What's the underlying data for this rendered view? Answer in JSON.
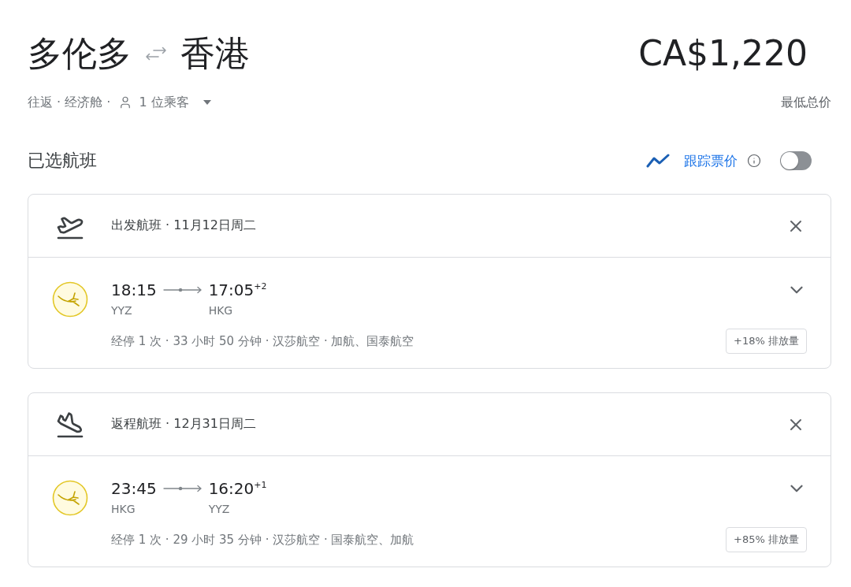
{
  "route": {
    "origin": "多伦多",
    "destination": "香港"
  },
  "price": {
    "amount": "CA$1,220",
    "note": "最低总价"
  },
  "trip": {
    "summary": "往返 · 经济舱 ·",
    "passengers": "1 位乘客"
  },
  "selected_flights": {
    "title": "已选航班",
    "track_prices": {
      "label": "跟踪票价",
      "on": false
    }
  },
  "flights": [
    {
      "kind": "departure",
      "header": "出发航班 · 11月12日周二",
      "depart_time": "18:15",
      "arrive_time": "17:05$^{+2}$",
      "origin_code": "YYZ",
      "destination_code": "HKG",
      "details": "经停 1 次 · 33 小时 50 分钟 · 汉莎航空 · 加航、国泰航空",
      "emissions": "+18% 排放量",
      "expanded": false
    },
    {
      "kind": "return",
      "header": "返程航班 · 12月31日周二",
      "depart_time": "23:45",
      "arrive_time": "16:20$^{+1}$",
      "origin_code": "HKG",
      "destination_code": "YYZ",
      "details": "经停 1 次 · 29 小时 35 分钟 · 汉莎航空 · 国泰航空、加航",
      "emissions": "+85% 排放量",
      "expanded": false
    }
  ]
}
